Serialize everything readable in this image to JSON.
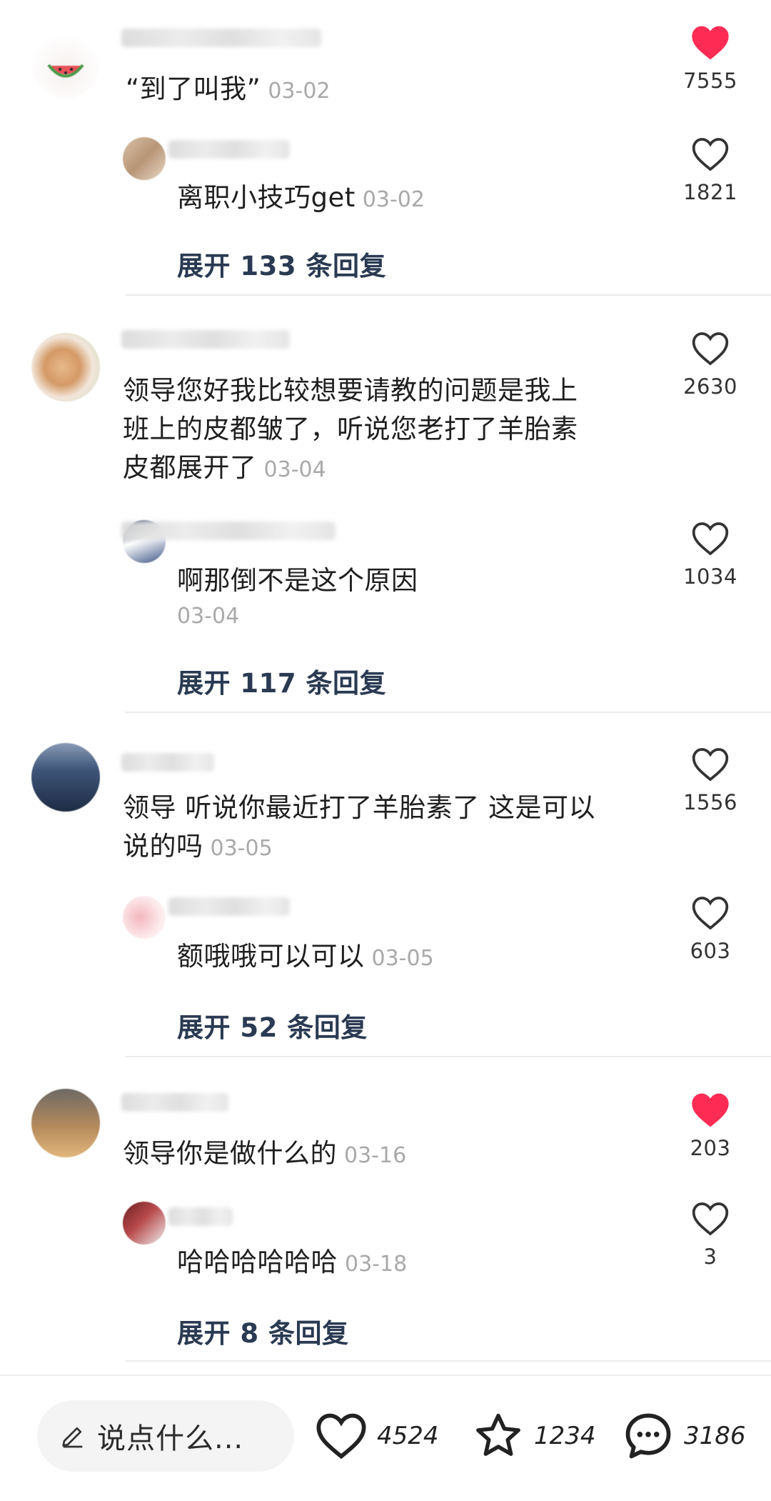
{
  "threads": [
    {
      "comment": {
        "text": "“到了叫我”",
        "date": "03-02",
        "likes": "7555",
        "liked": true
      },
      "reply": {
        "text": "离职小技巧get",
        "date": "03-02",
        "likes": "1821",
        "liked": false
      },
      "expand_label": "展开 133 条回复"
    },
    {
      "comment": {
        "text_line1": "领导您好我比较想要请教的问题是我上",
        "text_line2": "班上的皮都皱了，听说您老打了羊胎素",
        "text_line3": "皮都展开了",
        "date": "03-04",
        "likes": "2630",
        "liked": false
      },
      "reply": {
        "text": "啊那倒不是这个原因",
        "date": "03-04",
        "likes": "1034",
        "liked": false
      },
      "expand_label": "展开 117 条回复"
    },
    {
      "comment": {
        "text_line1": "领导 听说你最近打了羊胎素了 这是可以",
        "text_line2": "说的吗",
        "date": "03-05",
        "likes": "1556",
        "liked": false
      },
      "reply": {
        "text": "额哦哦可以可以",
        "date": "03-05",
        "likes": "603",
        "liked": false
      },
      "expand_label": "展开 52 条回复"
    },
    {
      "comment": {
        "text": "领导你是做什么的",
        "date": "03-16",
        "likes": "203",
        "liked": true
      },
      "reply": {
        "text": "哈哈哈哈哈哈",
        "date": "03-18",
        "likes": "3",
        "liked": false
      },
      "expand_label": "展开 8 条回复"
    }
  ],
  "bottom_bar": {
    "input_placeholder": "说点什么...",
    "likes": "4524",
    "favorites": "1234",
    "comments": "3186"
  },
  "colors": {
    "liked_heart": "#fe2c55",
    "outline_heart": "#333333",
    "expand_text": "#2a3a52",
    "date_text": "#a9a9a9"
  },
  "icons": [
    "heart-icon",
    "pencil-icon",
    "star-icon",
    "comment-bubble-icon"
  ]
}
